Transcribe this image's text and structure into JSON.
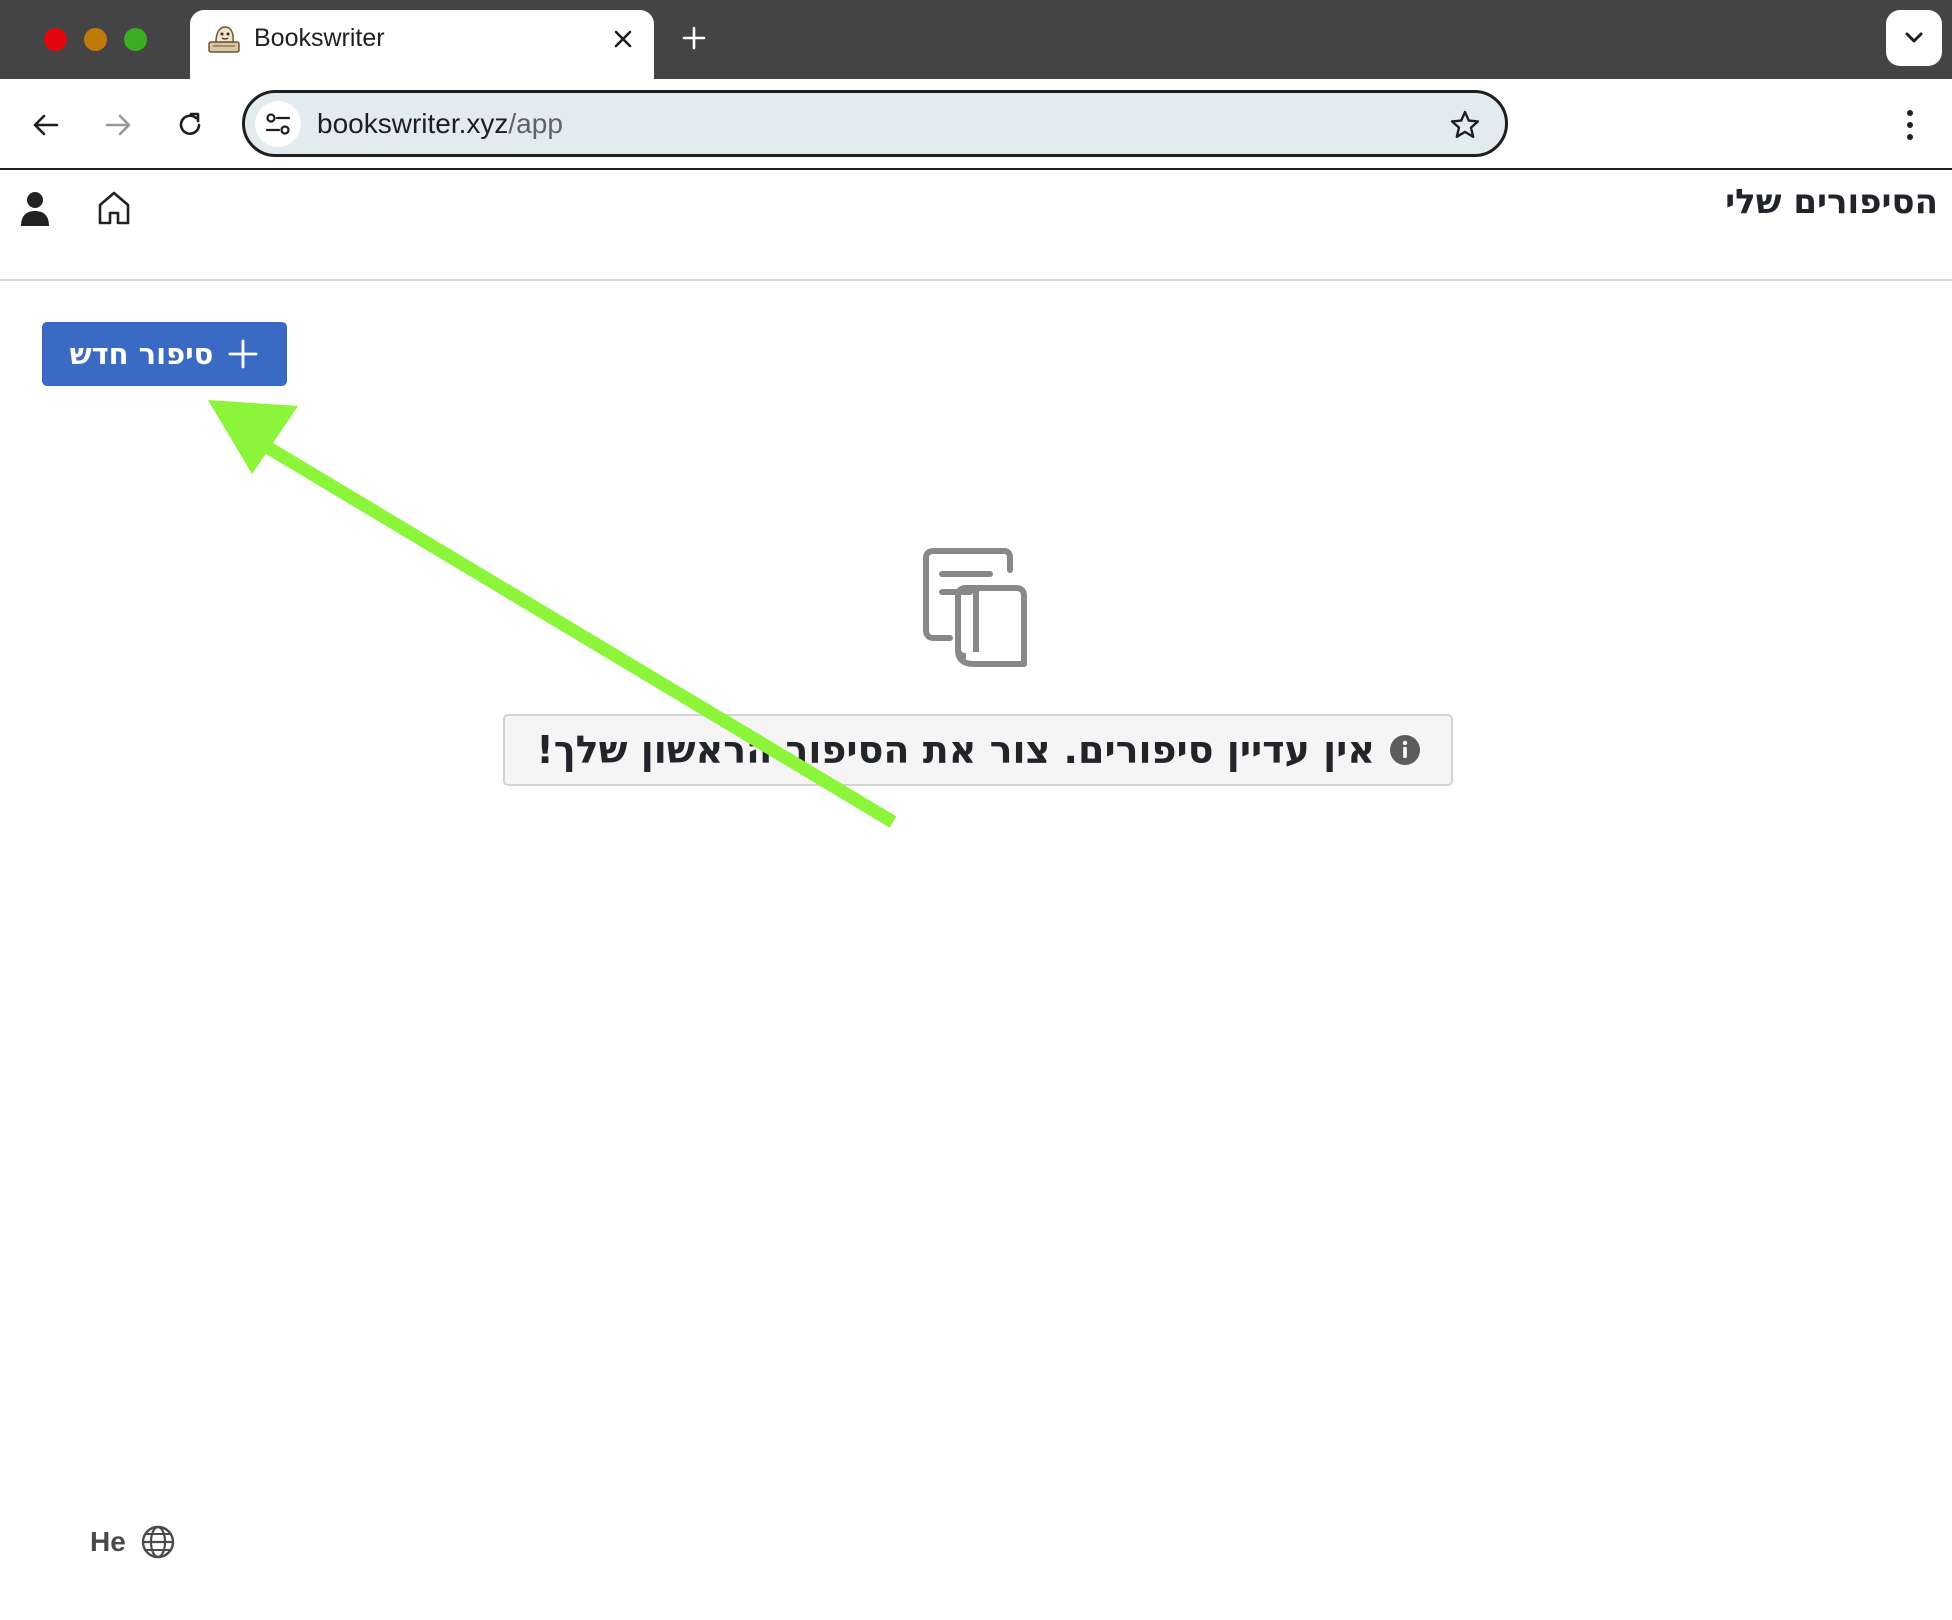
{
  "browser": {
    "tab_title": "Bookswriter",
    "url_host": "bookswriter.xyz",
    "url_path": "/app"
  },
  "app": {
    "page_title": "הסיפורים שלי",
    "new_story_label": "סיפור חדש",
    "empty_message": "אין עדיין סיפורים. צור את הסיפור הראשון שלך!",
    "language_label": "He"
  },
  "icons": {
    "favicon": "bookswriter-favicon",
    "user": "user-icon",
    "home": "home-icon",
    "plus": "plus-icon",
    "empty": "books-icon",
    "info": "info-icon",
    "globe": "globe-icon"
  },
  "colors": {
    "primary_button": "#3b6ac5",
    "annotation_arrow": "#8cf53a",
    "alert_background": "#f5f5f5"
  }
}
